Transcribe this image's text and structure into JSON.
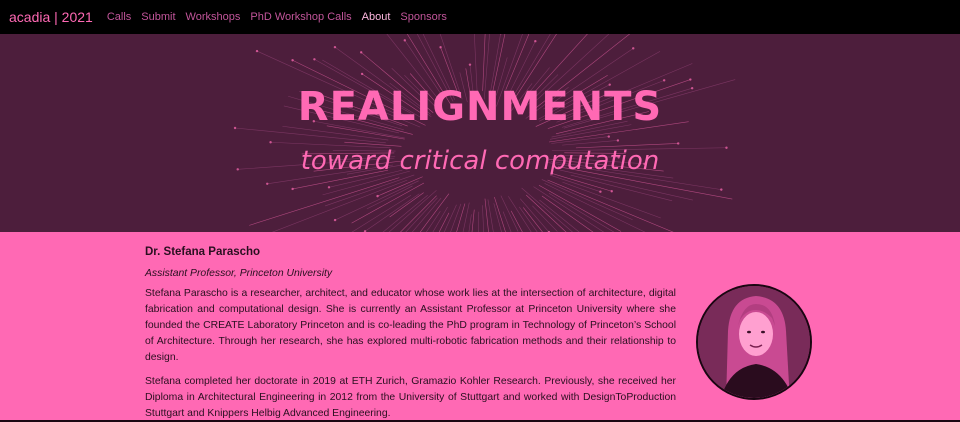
{
  "nav": {
    "brand": "acadia | 2021",
    "links": [
      "Calls",
      "Submit",
      "Workshops",
      "PhD Workshop Calls",
      "About",
      "Sponsors"
    ],
    "active": "About"
  },
  "hero": {
    "title": "REALIGNMENTS",
    "subtitle": "toward critical computation"
  },
  "profile": {
    "name": "Dr. Stefana Parascho",
    "role": "Assistant Professor, Princeton University",
    "paragraphs": [
      "Stefana Parascho is a researcher, architect, and educator whose work lies at the intersection of architecture, digital fabrication and computational design. She is currently an Assistant Professor at Princeton University where she founded the CREATE Laboratory Princeton and is co-leading the PhD program in Technology of Princeton’s School of Architecture. Through her research, she has explored multi-robotic fabrication methods and their relationship to design.",
      "Stefana completed her doctorate in 2019 at ETH Zurich, Gramazio Kohler Research. Previously, she received her Diploma in Architectural Engineering in 2012 from the University of Stuttgart and worked with DesignToProduction Stuttgart and Knippers Helbig Advanced Engineering."
    ]
  },
  "colors": {
    "navbar": "#000000",
    "brand": "#ff69b4",
    "hero_bg": "#4d1e3c",
    "accent": "#ff69b4",
    "text": "#2a0f20"
  }
}
